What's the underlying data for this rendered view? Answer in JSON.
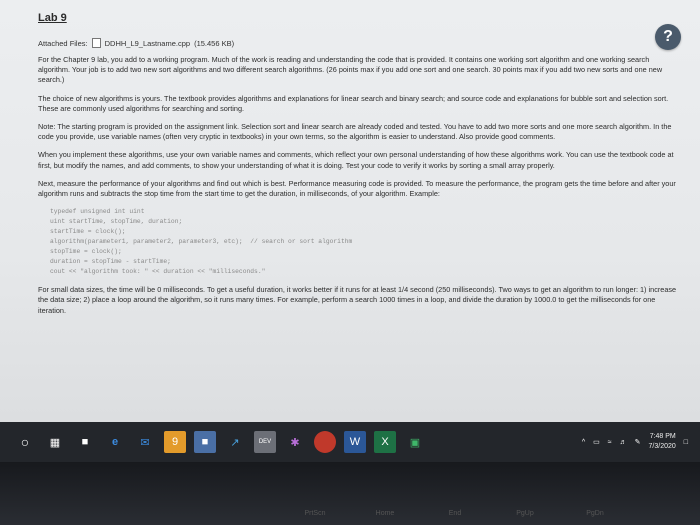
{
  "page": {
    "title": "Lab 9",
    "attached_label": "Attached Files:",
    "file_name": "DDHH_L9_Lastname.cpp",
    "file_size": "(15.456 KB)",
    "paragraphs": [
      "For the Chapter 9 lab, you add to a working program. Much of the work is reading and understanding the code that is provided. It contains one working sort algorithm and one working search algorithm. Your job is to add two new sort algorithms and two different search algorithms. (26 points max if you add one sort and one search. 30 points max if you add two new sorts and one new search.)",
      "The choice of new algorithms is yours. The textbook provides algorithms and explanations for linear search and binary search; and source code and explanations for bubble sort and selection sort. These are commonly used algorithms for searching and sorting.",
      "Note: The starting program is provided on the assignment link. Selection sort and linear search are already coded and tested. You have to add two more sorts and one more search algorithm. In the code you provide, use variable names (often very cryptic in textbooks) in your own terms, so the algorithm is easier to understand. Also provide good comments.",
      "When you implement these algorithms, use your own variable names and comments, which reflect your own personal understanding of how these algorithms work. You can use the textbook code at first, but modify the names, and add comments, to show your understanding of what it is doing. Test your code to verify it works by sorting a small array properly.",
      "Next, measure the performance of your algorithms and find out which is best. Performance measuring code is provided. To measure the performance, the program gets the time before and after your algorithm runs and subtracts the stop time from the start time to get the duration, in milliseconds, of your algorithm. Example:"
    ],
    "code_lines": [
      "typedef unsigned int uint",
      "uint startTime, stopTime, duration;",
      "startTime = clock();",
      "algorithm(parameter1, parameter2, parameter3, etc);  // search or sort algorithm",
      "stopTime = clock();",
      "duration = stopTime - startTime;",
      "cout << \"algorithm took: \" << duration << \"milliseconds.\""
    ],
    "final_paragraph": "For small data sizes, the time will be 0 milliseconds. To get a useful duration, it works better if it runs for at least 1/4 second (250 milliseconds). Two ways to get an algorithm to run longer: 1) increase the data size; 2) place a loop around the algorithm, so it runs many times. For example, perform a search 1000 times in a loop, and divide the duration by 1000.0 to get the milliseconds for one iteration.",
    "help_label": "?"
  },
  "taskbar": {
    "time": "7:48 PM",
    "date": "7/3/2020",
    "tray_caret": "^"
  },
  "keyboard": {
    "keys": [
      "",
      "",
      "",
      "",
      "PrtScn",
      "Home",
      "End",
      "PgUp",
      "PgDn",
      ""
    ]
  }
}
